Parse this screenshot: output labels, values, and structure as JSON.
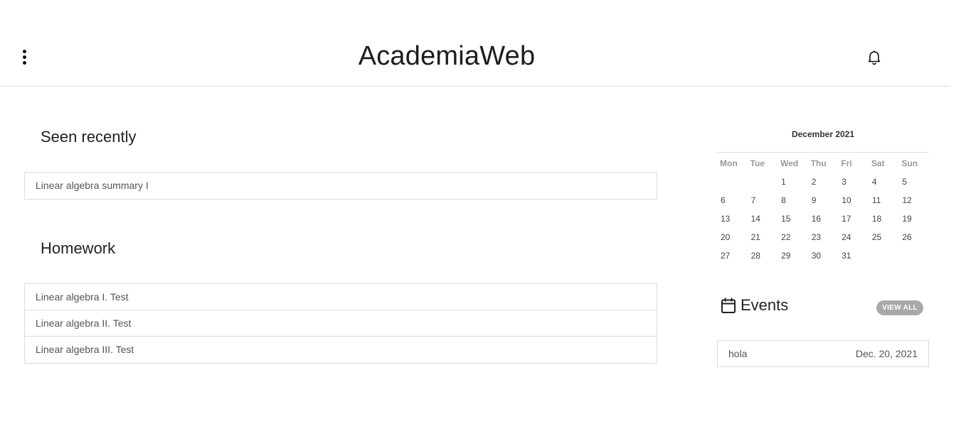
{
  "header": {
    "title": "AcademiaWeb",
    "menu_icon": "kebab-menu-icon",
    "notifications_icon": "bell-icon"
  },
  "seen_recently": {
    "title": "Seen recently",
    "items": [
      "Linear algebra summary I"
    ]
  },
  "homework": {
    "title": "Homework",
    "items": [
      "Linear algebra I. Test",
      "Linear algebra II. Test",
      "Linear algebra III. Test"
    ]
  },
  "calendar": {
    "month_label": "December 2021",
    "weekdays": [
      "Mon",
      "Tue",
      "Wed",
      "Thu",
      "Fri",
      "Sat",
      "Sun"
    ],
    "weeks": [
      [
        "",
        "",
        "1",
        "2",
        "3",
        "4",
        "5"
      ],
      [
        "6",
        "7",
        "8",
        "9",
        "10",
        "11",
        "12"
      ],
      [
        "13",
        "14",
        "15",
        "16",
        "17",
        "18",
        "19"
      ],
      [
        "20",
        "21",
        "22",
        "23",
        "24",
        "25",
        "26"
      ],
      [
        "27",
        "28",
        "29",
        "30",
        "31",
        "",
        ""
      ]
    ]
  },
  "events": {
    "title": "Events",
    "icon": "calendar-icon",
    "view_all_label": "VIEW ALL",
    "items": [
      {
        "name": "hola",
        "date": "Dec. 20, 2021"
      }
    ]
  },
  "colors": {
    "border": "#dcdcdc",
    "badge": "#a8a8a8",
    "muted_text": "#999999"
  }
}
